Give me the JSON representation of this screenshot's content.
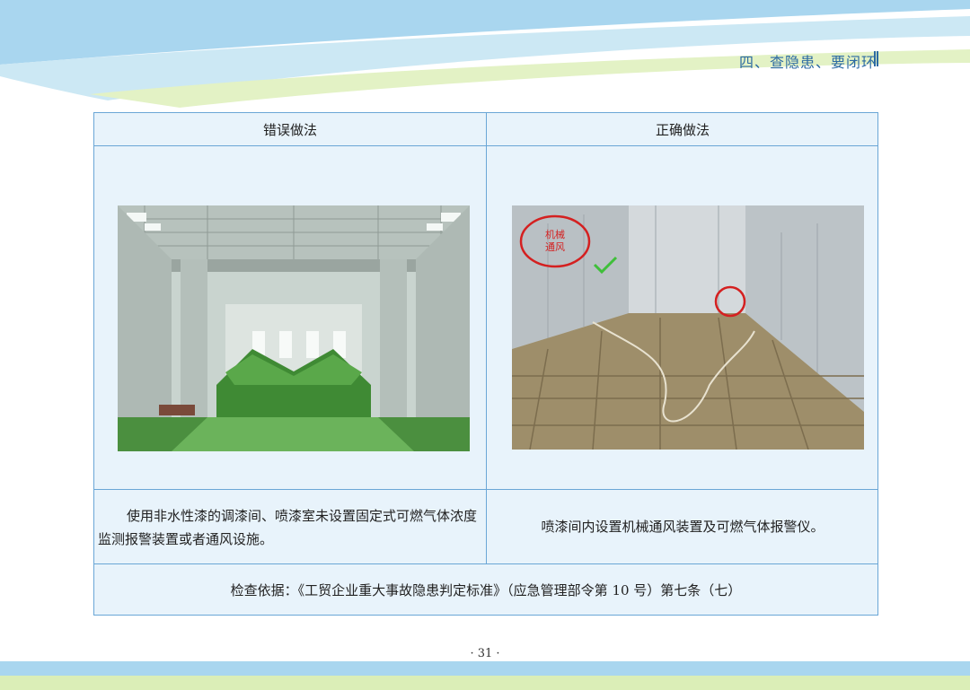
{
  "header": {
    "section_title": "四、查隐患、要闭环"
  },
  "table": {
    "col_wrong": "错误做法",
    "col_right": "正确做法",
    "wrong_desc": "使用非水性漆的调漆间、喷漆室未设置固定式可燃气体浓度监测报警装置或者通风设施。",
    "right_desc": "喷漆间内设置机械通风装置及可燃气体报警仪。",
    "right_photo_annotation": "机械通风",
    "basis": "检查依据：《工贸企业重大事故隐患判定标准》（应急管理部令第 10 号）第七条（七）"
  },
  "footer": {
    "page_number": "· 31 ·"
  },
  "colors": {
    "border": "#6aa6d6",
    "cell_bg": "#e8f3fb",
    "header_text": "#2c6aa3",
    "annotation_red": "#d42020",
    "check_green": "#3fbf3a"
  }
}
